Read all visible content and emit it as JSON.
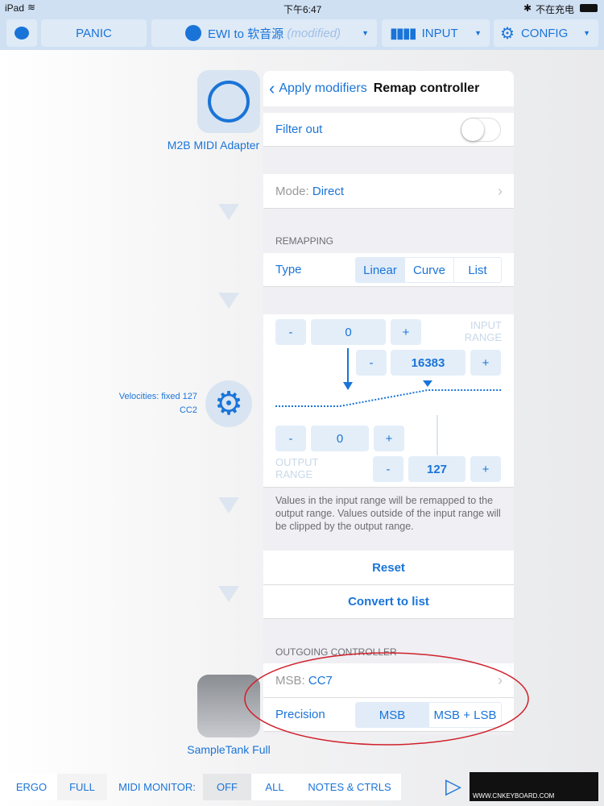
{
  "status": {
    "device": "iPad",
    "time": "下午6:47",
    "charging": "不在充电"
  },
  "topbar": {
    "panic": "PANIC",
    "preset": "EWI to 软音源",
    "preset_suffix": "(modified)",
    "input": "INPUT",
    "config": "CONFIG"
  },
  "left": {
    "adapter": "M2B MIDI Adapter",
    "velocities": "Velocities: fixed 127",
    "cc": "CC2",
    "synth": "SampleTank Full"
  },
  "panel": {
    "back": "Apply modifiers",
    "title": "Remap controller",
    "filter_out": "Filter out",
    "filter_on": false,
    "mode_label": "Mode:",
    "mode_value": "Direct",
    "remapping": "REMAPPING",
    "type_label": "Type",
    "types": [
      "Linear",
      "Curve",
      "List"
    ],
    "type_selected": "Linear",
    "input_range_label": "INPUT RANGE",
    "input_min": "0",
    "input_max": "16383",
    "output_range_label": "OUTPUT RANGE",
    "output_min": "0",
    "output_max": "127",
    "minus": "-",
    "plus": "+",
    "description": "Values in the input range will be remapped to the output range. Values outside of the input range will be clipped by the output range.",
    "reset": "Reset",
    "convert": "Convert to list",
    "outgoing": "OUTGOING CONTROLLER",
    "msb_label": "MSB:",
    "msb_value": "CC7",
    "precision_label": "Precision",
    "precisions": [
      "MSB",
      "MSB + LSB"
    ],
    "precision_selected": "MSB"
  },
  "bottom": {
    "ergo": "ERGO",
    "full": "FULL",
    "midi_monitor": "MIDI MONITOR:",
    "off": "OFF",
    "all": "ALL",
    "notes": "NOTES & CTRLS"
  },
  "watermark": "WWW.CNKEYBOARD.COM",
  "colors": {
    "accent": "#1a74d8",
    "annotation": "#d0202a"
  }
}
